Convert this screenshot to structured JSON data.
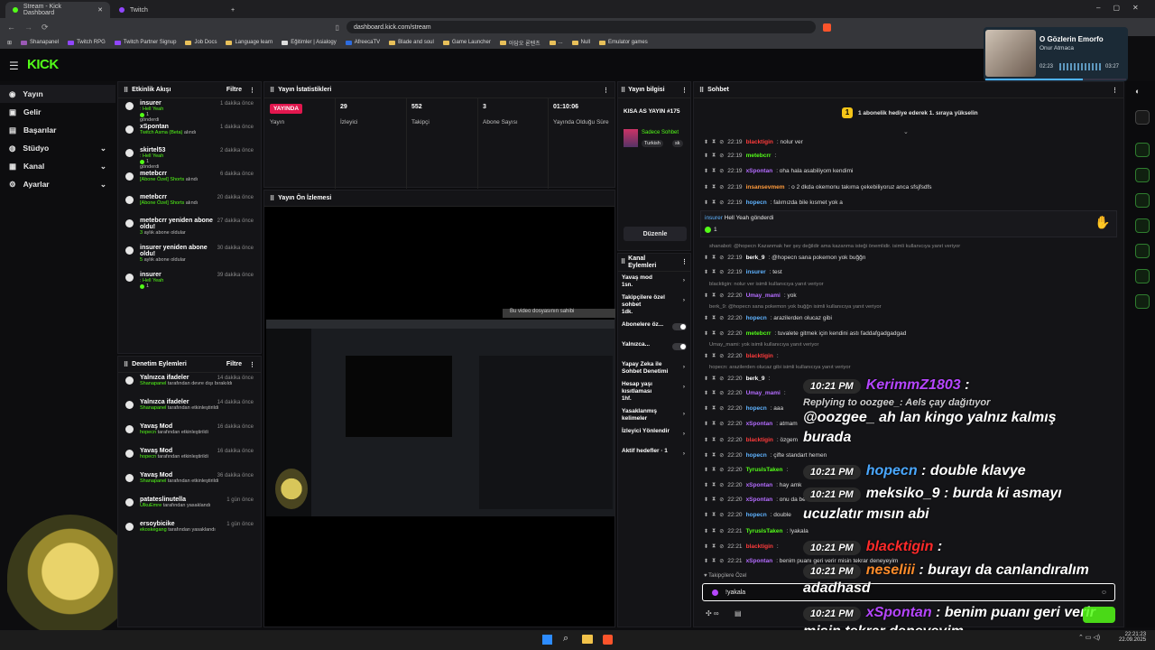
{
  "browser": {
    "tabs": [
      {
        "label": "Stream - Kick Dashboard",
        "active": true
      },
      {
        "label": "Twitch",
        "active": false
      }
    ],
    "url": "dashboard.kick.com/stream",
    "bookmarks": [
      "Shanapanel",
      "Twitch RPG",
      "Twitch Partner Signup",
      "Job Docs",
      "Language learn",
      "Eğitimler | Asialogy",
      "AfreecaTV",
      "Blade and soul",
      "Game Launcher",
      "아답오 론텐츠",
      "...",
      "Null",
      "Emulator games"
    ]
  },
  "media_player": {
    "title": "O Gözlerin Emorfo",
    "artist": "Onur Atmaca",
    "elapsed": "02:23",
    "total": "03:27",
    "progress": 0.69
  },
  "sidebar": {
    "items": [
      {
        "label": "Yayın",
        "icon": "video-icon",
        "selected": true
      },
      {
        "label": "Gelir",
        "icon": "money-icon"
      },
      {
        "label": "Başarılar",
        "icon": "trophy-icon"
      },
      {
        "label": "Stüdyo",
        "icon": "studio-icon",
        "chevron": true
      },
      {
        "label": "Kanal",
        "icon": "channel-icon",
        "chevron": true
      },
      {
        "label": "Ayarlar",
        "icon": "gear-icon",
        "chevron": true
      }
    ]
  },
  "activity": {
    "title": "Etkinlik Akışı",
    "filter": "Filtre",
    "events": [
      {
        "name": "insurer",
        "line1": ": Hell Yeah",
        "line2": "1",
        "line3": "gönderdi",
        "time": "1 dakika önce"
      },
      {
        "name": "xSpontan",
        "line1": "Twitch Asma (Beta)",
        "line1b": " alındı",
        "time": "1 dakika önce"
      },
      {
        "name": "skirtel53",
        "line1": ": Hell Yeah",
        "line2": "1",
        "line3": "gönderdi",
        "time": "2 dakika önce"
      },
      {
        "name": "metebcrr",
        "line1": "[Abone Özel] Shorts",
        "line1b": " alındı",
        "time": "6 dakika önce"
      },
      {
        "name": "metebcrr",
        "line1": "[Abone Özel] Shorts",
        "line1b": " alındı",
        "time": "20 dakika önce"
      },
      {
        "name": "metebcrr yeniden abone oldu!",
        "line1": "3",
        "line1b": " aylık abone oldular",
        "time": "27 dakika önce"
      },
      {
        "name": "insurer yeniden abone oldu!",
        "line1": "5",
        "line1b": " aylık abone oldular",
        "time": "30 dakika önce"
      },
      {
        "name": "insurer",
        "line1": ": Hell Yeah",
        "line2": "1",
        "time": "39 dakika önce"
      }
    ]
  },
  "moderation": {
    "title": "Denetim Eylemleri",
    "filter": "Filtre",
    "events": [
      {
        "name": "Yalnızca ifadeler",
        "by": "Shanapanel",
        "desc": " tarafından devre dışı bırakıldı",
        "time": "14 dakika önce"
      },
      {
        "name": "Yalnızca ifadeler",
        "by": "Shanapanel",
        "desc": " tarafından etkinleştirildi",
        "time": "14 dakika önce"
      },
      {
        "name": "Yavaş Mod",
        "by": "hopecn",
        "desc": " tarafından etkinleştirildi",
        "time": "16 dakika önce"
      },
      {
        "name": "Yavaş Mod",
        "by": "hopecn",
        "desc": " tarafından etkinleştirildi",
        "time": "16 dakika önce"
      },
      {
        "name": "Yavaş Mod",
        "by": "Shanapanel",
        "desc": " tarafından etkinleştirildi",
        "time": "36 dakika önce"
      },
      {
        "name": "patateslinutella",
        "by": "UlkuEmre",
        "desc": " tarafından yasaklandı",
        "time": "1 gün önce"
      },
      {
        "name": "ersoybicike",
        "by": "ekoskegang",
        "desc": " tarafından yasaklandı",
        "time": "1 gün önce"
      }
    ]
  },
  "stats": {
    "title": "Yayın İstatistikleri",
    "live_badge": "YAYINDA",
    "live_label": "Yayın",
    "items": [
      {
        "value": "29",
        "label": "İzleyici"
      },
      {
        "value": "552",
        "label": "Takipçi"
      },
      {
        "value": "3",
        "label": "Abone Sayısı"
      },
      {
        "value": "01:10:06",
        "label": "Yayında Olduğu Süre"
      }
    ]
  },
  "preview": {
    "title": "Yayın Ön İzlemesi",
    "notice": "Bu video dosyasının sahibi"
  },
  "stream_info": {
    "title": "Yayın bilgisi",
    "stream_title": "KISA AS YAYIN #175",
    "tag_title": "Sadece Sohbet",
    "tags": [
      "Turkish",
      "sk"
    ],
    "edit": "Düzenle"
  },
  "channel_actions": {
    "title": "Kanal Eylemleri",
    "items": [
      {
        "label": "Yavaş mod",
        "sub": "1sn."
      },
      {
        "label": "Takipçilere özel sohbet",
        "sub": "1dk."
      },
      {
        "label": "Abonelere öz...",
        "toggle": true
      },
      {
        "label": "Yalnızca...",
        "toggle": true
      },
      {
        "label": "Yapay Zeka ile Sohbet Denetimi"
      },
      {
        "label": "Hesap yaşı kısıtlaması",
        "sub": "1hf."
      },
      {
        "label": "Yasaklanmış kelimeler"
      },
      {
        "label": "İzleyici Yönlendir"
      },
      {
        "label": "Aktif hedefler · 1"
      }
    ]
  },
  "chat": {
    "title": "Sohbet",
    "pinned": "1 abonelik hediye ederek 1. sıraya yükselin",
    "gift_msg": {
      "user": "insurer",
      "text": " Hell Yeah gönderdi",
      "count": "1"
    },
    "rows": [
      {
        "time": "22:19",
        "user": "blacktigin",
        "color": "#ff3b3b",
        "text": ": nolur ver"
      },
      {
        "time": "22:19",
        "user": "metebcrr",
        "color": "#53fc18",
        "text": ":"
      },
      {
        "time": "22:19",
        "user": "xSpontan",
        "color": "#b46cff",
        "text": ": oha hala asabiliyom kendimi"
      },
      {
        "time": "22:19",
        "user": "insansevmem",
        "color": "#ff9a3b",
        "text": ": o 2 dkda okemonu takıma çekebiliyoruz anca sfsjfsdfs"
      },
      {
        "time": "22:19",
        "user": "hopecn",
        "color": "#5fb3ff",
        "text": ": falımızda bile kısmet yok a"
      },
      {
        "time": "22:19",
        "user": "berk_9",
        "color": "#ffffff",
        "text": ": @hopecn sana pokemon yok buğğn"
      },
      {
        "time": "22:19",
        "user": "insurer",
        "color": "#5fb3ff",
        "text": ": test"
      },
      {
        "time": "22:20",
        "user": "Umay_mami",
        "color": "#b46cff",
        "text": ": yok"
      },
      {
        "time": "22:20",
        "user": "hopecn",
        "color": "#5fb3ff",
        "text": ": arazilerden olucaz gibi"
      },
      {
        "time": "22:20",
        "user": "metebcrr",
        "color": "#53fc18",
        "text": ": tuvalete gitmek için kendini astı faddafgadgadgad"
      },
      {
        "time": "22:20",
        "user": "blacktigin",
        "color": "#ff3b3b",
        "text": ":"
      },
      {
        "time": "22:20",
        "user": "berk_9",
        "color": "#ffffff",
        "text": ":"
      },
      {
        "time": "22:20",
        "user": "Umay_mami",
        "color": "#b46cff",
        "text": ":"
      },
      {
        "time": "22:20",
        "user": "hopecn",
        "color": "#5fb3ff",
        "text": ": aaa"
      },
      {
        "time": "22:20",
        "user": "xSpontan",
        "color": "#b46cff",
        "text": ": atmam"
      },
      {
        "time": "22:20",
        "user": "blacktigin",
        "color": "#ff3b3b",
        "text": ": özgem"
      },
      {
        "time": "22:20",
        "user": "hopecn",
        "color": "#5fb3ff",
        "text": ": çifte standart hemen"
      },
      {
        "time": "22:20",
        "user": "TyrusIsTaken",
        "color": "#53fc18",
        "text": ":"
      },
      {
        "time": "22:20",
        "user": "xSpontan",
        "color": "#b46cff",
        "text": ": hay amk"
      },
      {
        "time": "22:20",
        "user": "xSpontan",
        "color": "#b46cff",
        "text": ": onu da be"
      },
      {
        "time": "22:20",
        "user": "hopecn",
        "color": "#5fb3ff",
        "text": ": double"
      },
      {
        "time": "22:21",
        "user": "TyrusIsTaken",
        "color": "#53fc18",
        "text": ": !yakala"
      },
      {
        "time": "22:21",
        "user": "blacktigin",
        "color": "#ff3b3b",
        "text": ":"
      },
      {
        "time": "22:21",
        "user": "xSpontan",
        "color": "#b46cff",
        "text": ": benim puanı geri verir misin tekrar deneyeyim"
      }
    ],
    "system": [
      "shanabot: @hopecn Kazanmak her şey değildir ama kazanma isteği önemlidir. isimli kullanıcıya yanıt veriyor",
      "blacktigin: nolur ver isimli kullanıcıya yanıt veriyor",
      "berk_9: @hopecn sana pokemon yok buğğn isimli kullanıcıya yanıt veriyor",
      "Umay_mami: yok isimli kullanıcıya yanıt veriyor",
      "hopecn: arazilerden olucaz gibi isimli kullanıcıya yanıt veriyor"
    ],
    "follower_label": "Takipçilere Özel",
    "input_value": "!yakala"
  },
  "overlay": [
    {
      "time": "10:21 PM",
      "user": "KerimmZ1803",
      "color": "#b646ff",
      "text": " :"
    },
    {
      "reply": "Replying to oozgee_: Aels çay dağıtıyor"
    },
    {
      "text": "@oozgee_ ah lan kingo yalnız kalmış"
    },
    {
      "text": "burada"
    },
    {
      "time": "10:21 PM",
      "user": "hopecn",
      "color": "#4aa8ff",
      "text": " : double klavye"
    },
    {
      "time": "10:21 PM",
      "user": "meksiko_9",
      "color": "#ffffff",
      "text": " : burda ki asmayı"
    },
    {
      "text": "ucuzlatır mısın abi"
    },
    {
      "time": "10:21 PM",
      "user": "blacktigin",
      "color": "#ff2a2a",
      "text": " :"
    },
    {
      "time": "10:21 PM",
      "user": "neseliii",
      "color": "#ff8c2a",
      "text": " : burayı da canlandıralım"
    },
    {
      "text": "adadhasd"
    },
    {
      "time": "10:21 PM",
      "user": "xSpontan",
      "color": "#b646ff",
      "text": " : benim puanı geri verir"
    },
    {
      "text": "misin tekrar deneyeyim"
    }
  ],
  "taskbar": {
    "time": "22:21:23",
    "date": "22.09.2025"
  },
  "colors": {
    "accent": "#53fc18",
    "live": "#e2174e",
    "bg": "#0d0d0f",
    "panel": "#141417"
  }
}
